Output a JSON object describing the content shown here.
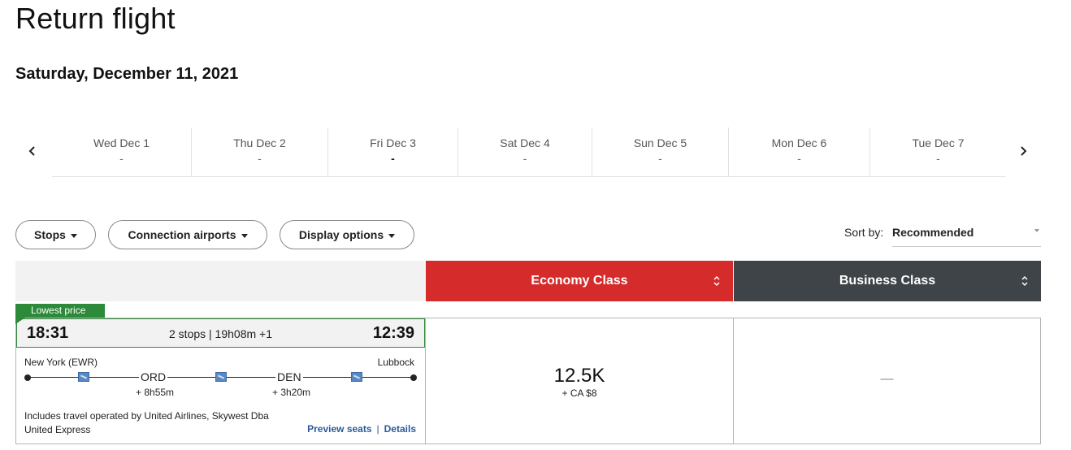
{
  "page": {
    "title": "Return flight",
    "date_heading": "Saturday, December 11, 2021"
  },
  "date_carousel": {
    "dates": [
      {
        "label": "Wed Dec 1",
        "price": "-"
      },
      {
        "label": "Thu Dec 2",
        "price": "-"
      },
      {
        "label": "Fri Dec 3",
        "price": "-",
        "selected": true
      },
      {
        "label": "Sat Dec 4",
        "price": "-"
      },
      {
        "label": "Sun Dec 5",
        "price": "-"
      },
      {
        "label": "Mon Dec 6",
        "price": "-"
      },
      {
        "label": "Tue Dec 7",
        "price": "-"
      }
    ]
  },
  "filters": {
    "stops_label": "Stops",
    "connection_label": "Connection airports",
    "display_label": "Display options"
  },
  "sort": {
    "label": "Sort by:",
    "value": "Recommended"
  },
  "class_headers": {
    "economy": "Economy Class",
    "business": "Business Class"
  },
  "flight": {
    "badge": "Lowest price",
    "departure_time": "18:31",
    "arrival_time": "12:39",
    "summary": "2 stops | 19h08m +1",
    "origin": "New York (EWR)",
    "destination": "Lubbock",
    "stops": [
      {
        "code": "ORD",
        "layover": "+ 8h55m"
      },
      {
        "code": "DEN",
        "layover": "+ 3h20m"
      }
    ],
    "operated_by": "Includes travel operated by United Airlines, Skywest Dba United Express",
    "preview_seats": "Preview seats",
    "link_separator": "|",
    "details": "Details",
    "economy_price": "12.5K",
    "economy_tax": "+ CA $8",
    "business_price": "—"
  },
  "colors": {
    "economy": "#d52b2b",
    "business": "#3f4448",
    "lowest_price_badge": "#2c8a3a",
    "link": "#2a5a9a"
  }
}
